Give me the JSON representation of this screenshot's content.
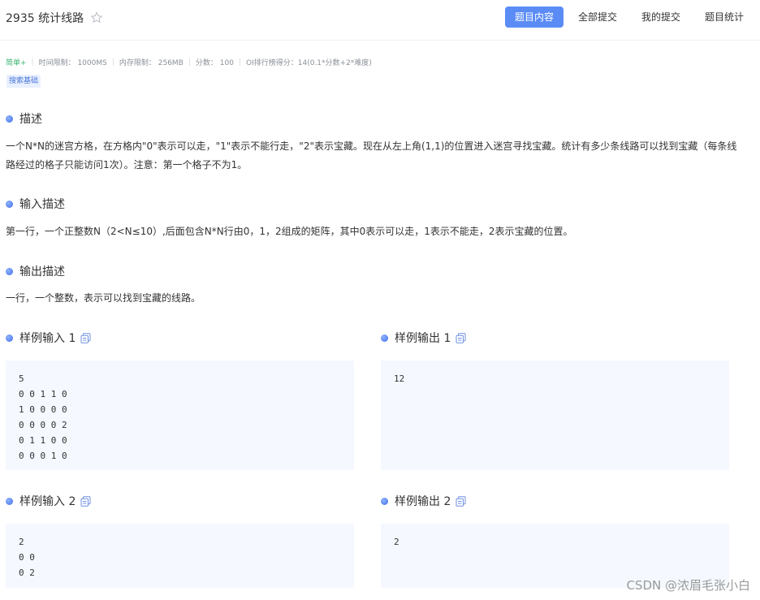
{
  "header": {
    "title": "2935 统计线路",
    "tabs": [
      {
        "label": "题目内容",
        "active": true
      },
      {
        "label": "全部提交",
        "active": false
      },
      {
        "label": "我的提交",
        "active": false
      },
      {
        "label": "题目统计",
        "active": false
      }
    ]
  },
  "meta": {
    "level": "简单+",
    "time_limit": "时间限制：  1000MS",
    "memory_limit": "内存限制：  256MB",
    "score": "分数：  100",
    "oi_rank": "OI排行榜得分：14(0.1*分数+2*难度)",
    "tag": "搜索基础"
  },
  "sections": {
    "desc_title": "描述",
    "desc_line1": "一个N*N的迷宫方格，在方格内\"0\"表示可以走，\"1\"表示不能行走，\"2\"表示宝藏。现在从左上角(1,1)的位置进入迷宫寻找宝藏。统计有多少条线路可以找到宝藏（每条线",
    "desc_line2": "路经过的格子只能访问1次）。注意：第一个格子不为1。",
    "input_title": "输入描述",
    "input_text": "第一行，一个正整数N（2<N≤10）,后面包含N*N行由0，1，2组成的矩阵，其中0表示可以走，1表示不能走，2表示宝藏的位置。",
    "output_title": "输出描述",
    "output_text": "一行，一个整数，表示可以找到宝藏的线路。"
  },
  "samples": {
    "in1_title": "样例输入 1",
    "in1_code": "5\n0 0 1 1 0\n1 0 0 0 0\n0 0 0 0 2\n0 1 1 0 0\n0 0 0 1 0",
    "out1_title": "样例输出 1",
    "out1_code": "12",
    "in2_title": "样例输入 2",
    "in2_code": "2\n0 0\n0 2",
    "out2_title": "样例输出 2",
    "out2_code": "2"
  },
  "watermark": "CSDN @浓眉毛张小白",
  "colors": {
    "accent": "#5b8cf6",
    "easy": "#3cb371",
    "code_bg": "#f5f8fe"
  },
  "icons": {
    "star": "star-icon",
    "copy": "copy-icon",
    "bullet": "bullet-dot-icon"
  }
}
